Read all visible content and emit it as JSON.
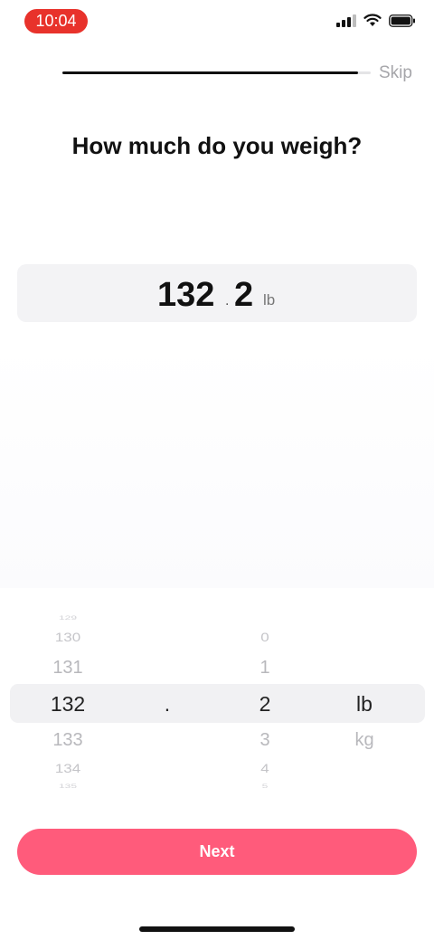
{
  "status_bar": {
    "time": "10:04",
    "icons": [
      "cellular-signal-icon",
      "wifi-icon",
      "battery-icon"
    ],
    "time_pill_color": "#e8322b"
  },
  "onboarding": {
    "progress_fraction": 0.96,
    "skip_label": "Skip"
  },
  "question": "How much do you weigh?",
  "display": {
    "whole": "132",
    "separator": ".",
    "fraction": "2",
    "unit": "lb"
  },
  "picker": {
    "whole": [
      "129",
      "130",
      "131",
      "132",
      "133",
      "134",
      "135"
    ],
    "separator": ".",
    "fraction": [
      "",
      "0",
      "1",
      "2",
      "3",
      "4",
      "5"
    ],
    "unit": [
      "",
      "",
      "",
      "lb",
      "kg",
      "",
      ""
    ]
  },
  "next_label": "Next",
  "colors": {
    "accent": "#ff5b7b",
    "text": "#111111",
    "muted": "#a6a6aa"
  }
}
